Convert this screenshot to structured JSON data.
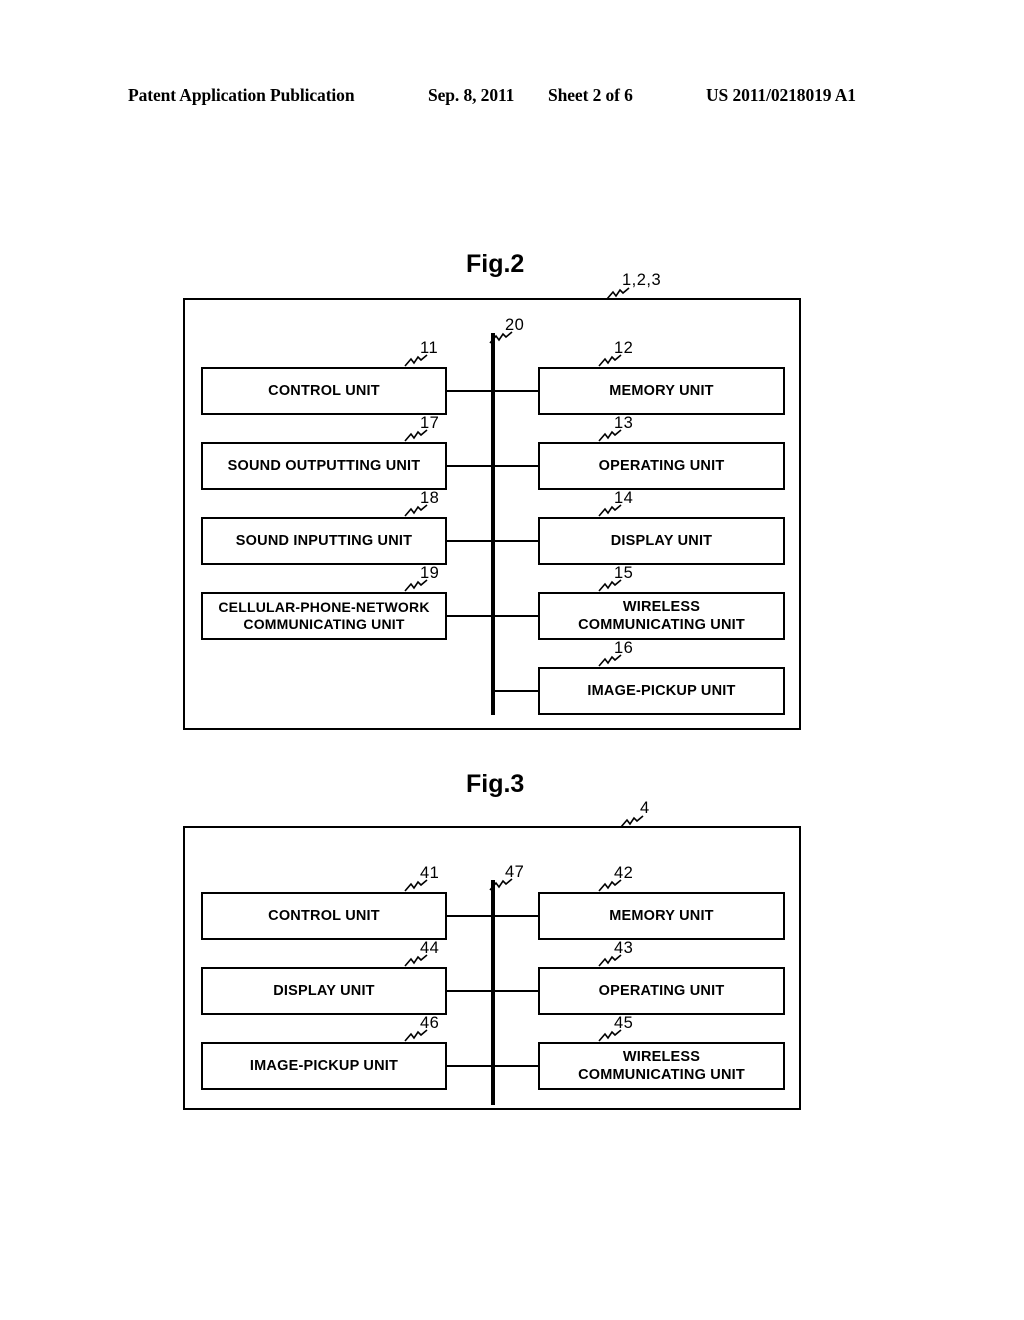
{
  "header": {
    "publication": "Patent Application Publication",
    "date": "Sep. 8, 2011",
    "sheet": "Sheet 2 of 6",
    "patent_number": "US 2011/0218019 A1"
  },
  "figures": [
    {
      "title": "Fig.2",
      "outer_ref": "1,2,3",
      "bus_ref": "20",
      "left_units": [
        {
          "ref": "11",
          "label": "CONTROL UNIT"
        },
        {
          "ref": "17",
          "label": "SOUND OUTPUTTING UNIT"
        },
        {
          "ref": "18",
          "label": "SOUND INPUTTING UNIT"
        },
        {
          "ref": "19",
          "label": "CELLULAR-PHONE-NETWORK\nCOMMUNICATING UNIT"
        }
      ],
      "right_units": [
        {
          "ref": "12",
          "label": "MEMORY UNIT"
        },
        {
          "ref": "13",
          "label": "OPERATING UNIT"
        },
        {
          "ref": "14",
          "label": "DISPLAY UNIT"
        },
        {
          "ref": "15",
          "label": "WIRELESS\nCOMMUNICATING UNIT"
        },
        {
          "ref": "16",
          "label": "IMAGE-PICKUP UNIT"
        }
      ]
    },
    {
      "title": "Fig.3",
      "outer_ref": "4",
      "bus_ref": "47",
      "left_units": [
        {
          "ref": "41",
          "label": "CONTROL UNIT"
        },
        {
          "ref": "44",
          "label": "DISPLAY UNIT"
        },
        {
          "ref": "46",
          "label": "IMAGE-PICKUP UNIT"
        }
      ],
      "right_units": [
        {
          "ref": "42",
          "label": "MEMORY UNIT"
        },
        {
          "ref": "43",
          "label": "OPERATING UNIT"
        },
        {
          "ref": "45",
          "label": "WIRELESS\nCOMMUNICATING UNIT"
        }
      ]
    }
  ],
  "colors": {
    "ink": "#000000",
    "paper": "#ffffff"
  }
}
